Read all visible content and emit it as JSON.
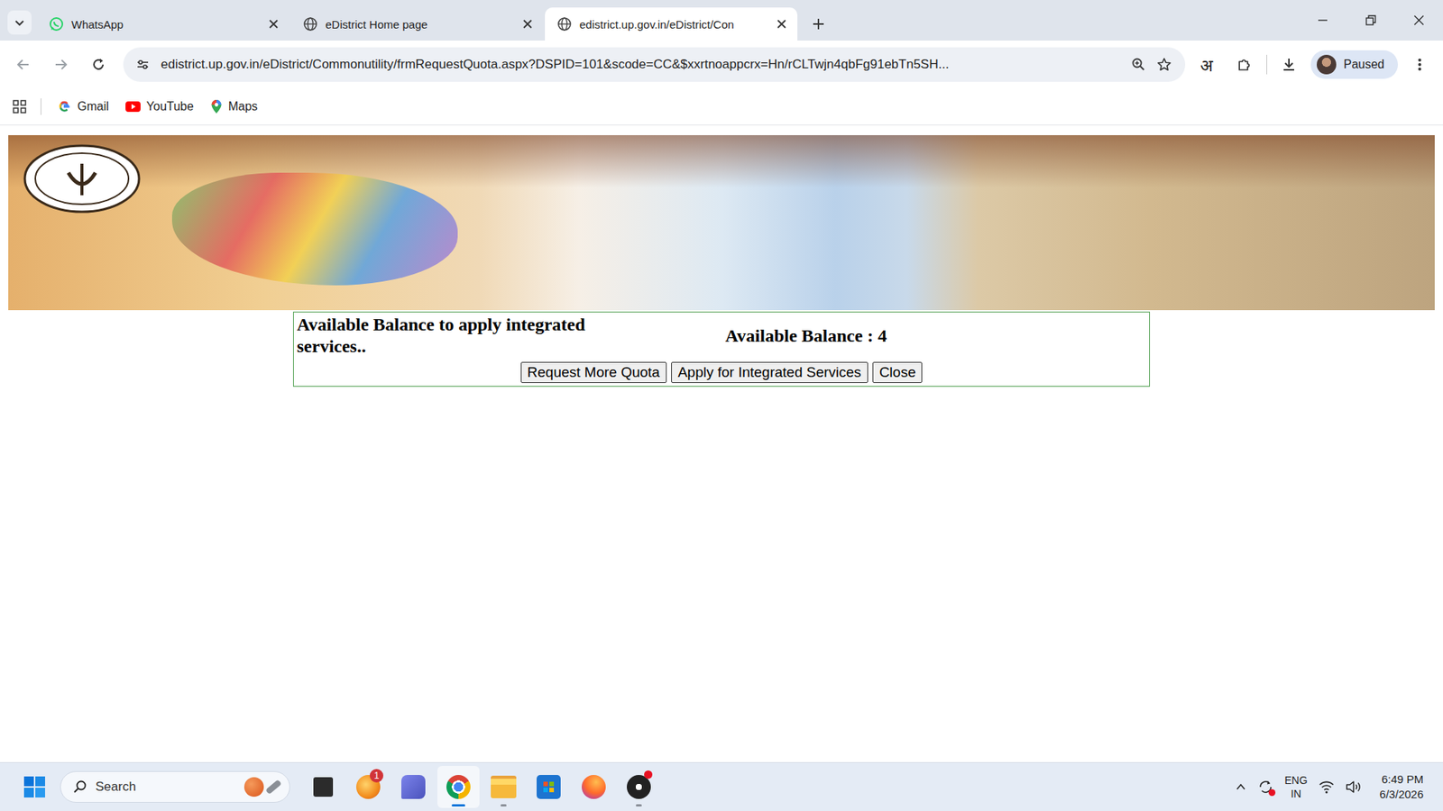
{
  "browser": {
    "tabs": [
      {
        "label": "WhatsApp",
        "selected": false,
        "kind": "whatsapp"
      },
      {
        "label": "eDistrict Home page",
        "selected": false,
        "kind": "globe"
      },
      {
        "label": "edistrict.up.gov.in/eDistrict/Con",
        "selected": true,
        "kind": "globe"
      }
    ],
    "address": "edistrict.up.gov.in/eDistrict/Commonutility/frmRequestQuota.aspx?DSPID=101&scode=CC&$xxrtnoappcrx=Hn/rCLTwjn4qbFg91ebTn5SH...",
    "translate_label": "अ",
    "profile": {
      "status": "Paused"
    },
    "bookmarks": [
      {
        "label": "Gmail",
        "kind": "gmail"
      },
      {
        "label": "YouTube",
        "kind": "youtube"
      },
      {
        "label": "Maps",
        "kind": "maps"
      }
    ]
  },
  "quota_box": {
    "label": "Available Balance to apply integrated services..",
    "balance": "Available Balance : 4",
    "buttons": [
      "Request More Quota",
      "Apply for Integrated Services",
      "Close"
    ]
  },
  "taskbar": {
    "search_placeholder": "Search",
    "apps": [
      {
        "kind": "terminal",
        "running": false,
        "selected": false,
        "badge": "",
        "alert": false
      },
      {
        "kind": "edge",
        "running": false,
        "selected": false,
        "badge": "1",
        "alert": false
      },
      {
        "kind": "chat",
        "running": false,
        "selected": false,
        "badge": "",
        "alert": false
      },
      {
        "kind": "chrome",
        "running": true,
        "selected": true,
        "badge": "",
        "alert": false
      },
      {
        "kind": "folder",
        "running": true,
        "selected": false,
        "badge": "",
        "alert": false
      },
      {
        "kind": "store",
        "running": false,
        "selected": false,
        "badge": "",
        "alert": false
      },
      {
        "kind": "firefox",
        "running": false,
        "selected": false,
        "badge": "",
        "alert": false
      },
      {
        "kind": "app",
        "running": true,
        "selected": false,
        "badge": "",
        "alert": true
      }
    ],
    "tray": {
      "language": "ENG",
      "region": "IN",
      "time": "6:49 PM",
      "date": "6/3/2026",
      "sync_alert": true
    }
  }
}
